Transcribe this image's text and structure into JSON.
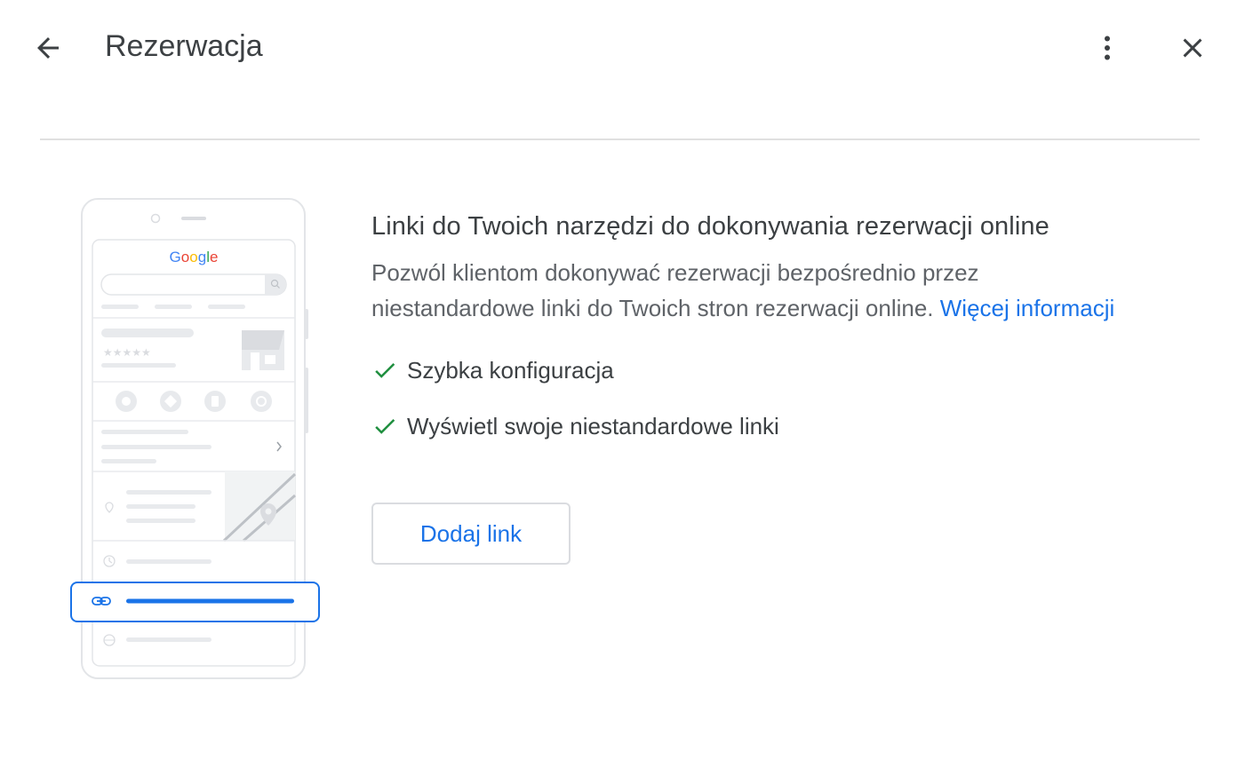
{
  "header": {
    "title": "Rezerwacja",
    "back_icon": "arrow-back-icon",
    "more_icon": "more-vert-icon",
    "close_icon": "close-icon"
  },
  "illustration": {
    "logo_text": "Google",
    "logo_colors": [
      "#4285f4",
      "#ea4335",
      "#fbbc05",
      "#4285f4",
      "#34a853",
      "#ea4335"
    ],
    "highlight_color": "#1a73e8"
  },
  "main": {
    "heading": "Linki do Twoich narzędzi do dokonywania rezerwacji online",
    "description": "Pozwól klientom dokonywać rezerwacji bezpośrednio przez niestandardowe linki do Twoich stron rezerwacji online.",
    "learn_more": "Więcej informacji",
    "features": [
      {
        "label": "Szybka konfiguracja",
        "icon": "check-icon"
      },
      {
        "label": "Wyświetl swoje niestandardowe linki",
        "icon": "check-icon"
      }
    ],
    "add_button": "Dodaj link"
  },
  "colors": {
    "accent": "#1a73e8",
    "check": "#1e8e3e",
    "text": "#3c4043",
    "secondary_text": "#5f6368"
  }
}
